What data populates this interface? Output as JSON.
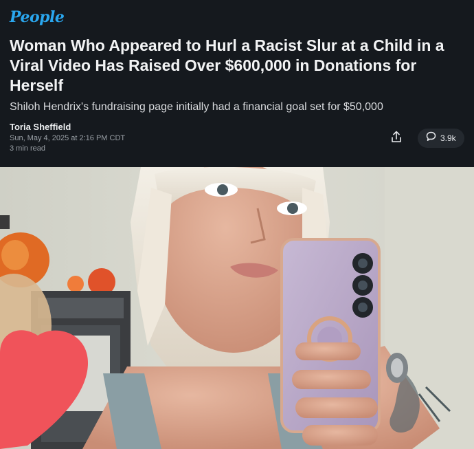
{
  "brand": {
    "logo_text": "People",
    "logo_color": "#2aa7ef"
  },
  "article": {
    "headline": "Woman Who Appeared to Hurl a Racist Slur at a Child in a Viral Video Has Raised Over $600,000 in Donations for Herself",
    "dek": "Shiloh Hendrix's fundraising page initially had a financial goal set for $50,000",
    "author": "Toria Sheffield",
    "date": "Sun, May 4, 2025 at 2:16 PM CDT",
    "read_time": "3 min read"
  },
  "actions": {
    "share_icon": "share-icon",
    "comment_icon": "comment-icon",
    "comment_count": "3.9k"
  },
  "colors": {
    "header_bg": "#15191e",
    "text_primary": "#f2f3f4",
    "text_secondary": "#9aa0a6",
    "pill_bg": "#24292f"
  }
}
